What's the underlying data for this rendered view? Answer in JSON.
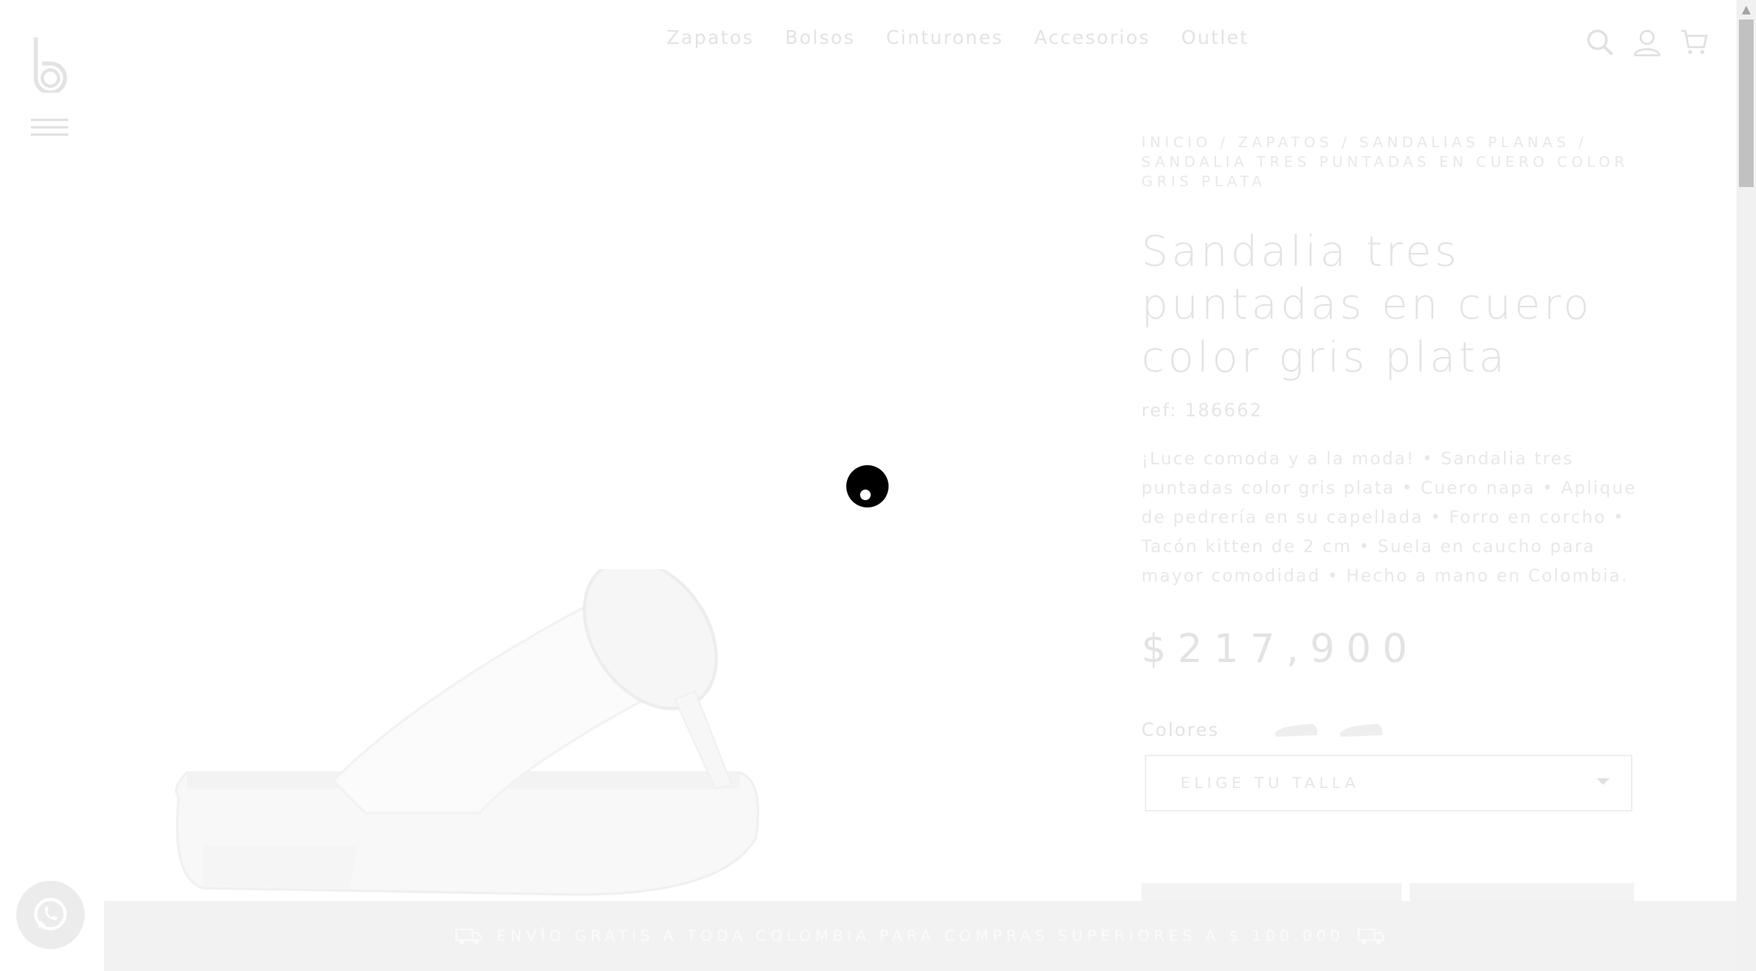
{
  "header": {
    "nav": [
      "Zapatos",
      "Bolsos",
      "Cinturones",
      "Accesorios",
      "Outlet"
    ]
  },
  "product": {
    "breadcrumb": "INICIO / ZAPATOS / SANDALIAS PLANAS / SANDALIA TRES PUNTADAS EN CUERO COLOR GRIS PLATA",
    "title": "Sandalia tres puntadas en cuero color gris plata",
    "ref": "ref: 186662",
    "description": "¡Luce comoda y a la moda! • Sandalia tres puntadas color gris plata • Cuero napa • Aplique de pedrería en su capellada • Forro en corcho • Tacón kitten de 2 cm • Suela en caucho para mayor comodidad • Hecho a mano en Colombia.",
    "price": "$217,900",
    "colors_label": "Colores",
    "size_select": "ELIGE TU TALLA"
  },
  "banner": {
    "text": "ENVÍO GRATIS A TODA COLOMBIA PARA COMPRAS SUPERIORES A $ 100.000"
  },
  "icons": [
    "logo-b-icon",
    "hamburger-menu-icon",
    "search-icon",
    "user-icon",
    "cart-icon",
    "whatsapp-icon",
    "truck-icon",
    "scroll-up-icon"
  ],
  "colors": {
    "background": "#ffffff",
    "faded_text": "#e3e3e3",
    "banner_bg": "#f2f2f2",
    "loader": "#000000"
  }
}
